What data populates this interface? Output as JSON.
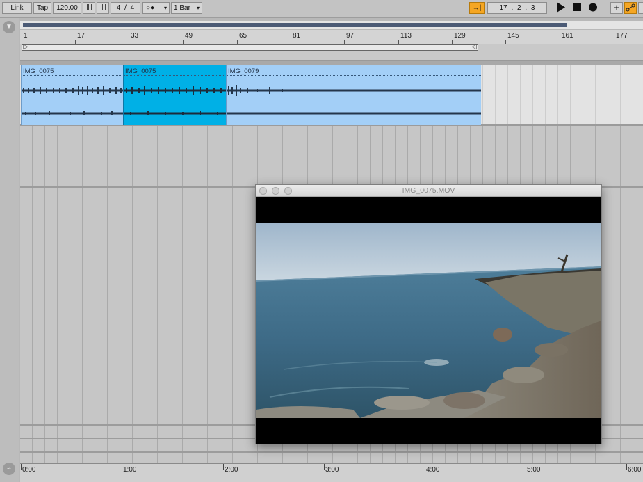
{
  "control_bar": {
    "link_label": "Link",
    "tap_label": "Tap",
    "tempo": "120.00",
    "time_sig_num": "4",
    "time_sig_sep": "/",
    "time_sig_den": "4",
    "metronome_symbol": "○●",
    "quantize": "1 Bar",
    "position_bar": "17",
    "position_beat": "2",
    "position_sixteenth": "3",
    "accent_color": "#f5a623"
  },
  "beat_ruler": [
    "1",
    "17",
    "33",
    "49",
    "65",
    "81",
    "97",
    "113",
    "129",
    "145",
    "161",
    "177"
  ],
  "clips": [
    {
      "name": "IMG_0075",
      "selected": false
    },
    {
      "name": "IMG_0075",
      "selected": true
    },
    {
      "name": "IMG_0079",
      "selected": false
    }
  ],
  "time_ruler": [
    "0:00",
    "1:00",
    "2:00",
    "3:00",
    "4:00",
    "5:00",
    "6:00"
  ],
  "video_window": {
    "title": "IMG_0075.MOV"
  },
  "colors": {
    "clip": "#a3cff7",
    "clip_selected": "#00b0e6"
  }
}
